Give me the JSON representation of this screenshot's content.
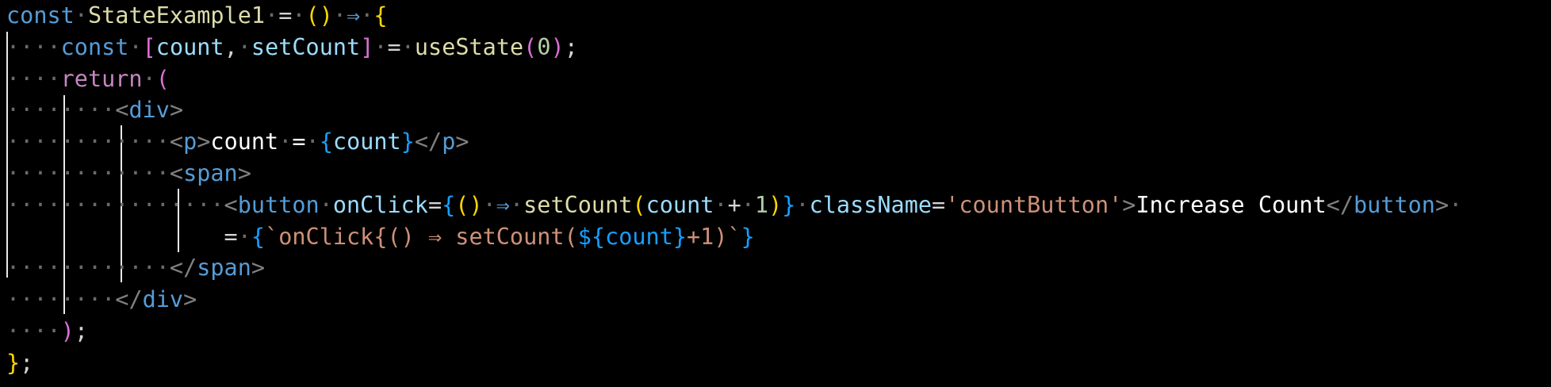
{
  "editor": {
    "theme": "dark",
    "colors": {
      "background": "#000000",
      "keyword": "#569cd6",
      "control": "#c586c0",
      "function": "#dcdcaa",
      "variable": "#9cdcfe",
      "number": "#b5cea8",
      "string": "#ce9178",
      "bracket_level1": "#ffd700",
      "bracket_level2": "#da70d6",
      "bracket_level3": "#179fff"
    },
    "tokens": {
      "const": "const",
      "component": "StateExample1",
      "eq": "=",
      "arrow": "⇒",
      "count": "count",
      "setCount": "setCount",
      "useState": "useState",
      "zero": "0",
      "return": "return",
      "div": "div",
      "p": "p",
      "p_text": "count",
      "span": "span",
      "button": "button",
      "onClick": "onClick",
      "one": "1",
      "plus": "+",
      "className": "className",
      "class_value": "'countButton'",
      "button_text": "Increase Count",
      "hint_eq": "=",
      "hint_value": "`onClick{() ⇒ setCount(",
      "hint_var": "${count}",
      "hint_tail": "+1)`"
    }
  }
}
